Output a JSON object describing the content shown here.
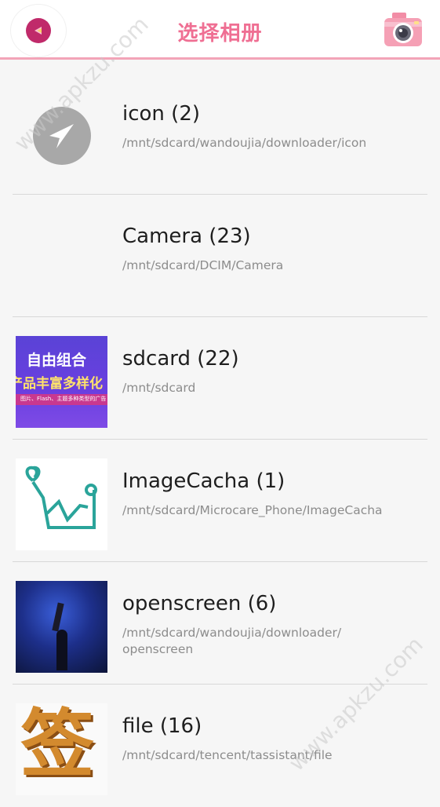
{
  "header": {
    "title": "选择相册",
    "back_icon": "back-play-icon",
    "camera_icon": "camera-icon",
    "accent": "#ef6f93"
  },
  "albums": [
    {
      "name": "icon (2)",
      "path": "/mnt/sdcard/wandoujia/downloader/icon",
      "thumb": "gray-arrow-icon"
    },
    {
      "name": "Camera (23)",
      "path": "/mnt/sdcard/DCIM/Camera",
      "thumb": "blank"
    },
    {
      "name": "sdcard (22)",
      "path": "/mnt/sdcard",
      "thumb": "purple-banner",
      "thumb_text": [
        "自由组合",
        "产品丰富多样化",
        "图片、Flash、主题多种类型的广告"
      ]
    },
    {
      "name": "ImageCacha (1)",
      "path": "/mnt/sdcard/Microcare_Phone/ImageCacha",
      "thumb": "stethoscope-chart-icon"
    },
    {
      "name": "openscreen (6)",
      "path": "/mnt/sdcard/wandoujia/downloader/ openscreen",
      "thumb": "blue-smoke-photo"
    },
    {
      "name": "file (16)",
      "path": "/mnt/sdcard/tencent/tassistant/file",
      "thumb": "orange-glyph",
      "thumb_text": [
        "签"
      ]
    }
  ],
  "watermark": "www.apkzu.com"
}
